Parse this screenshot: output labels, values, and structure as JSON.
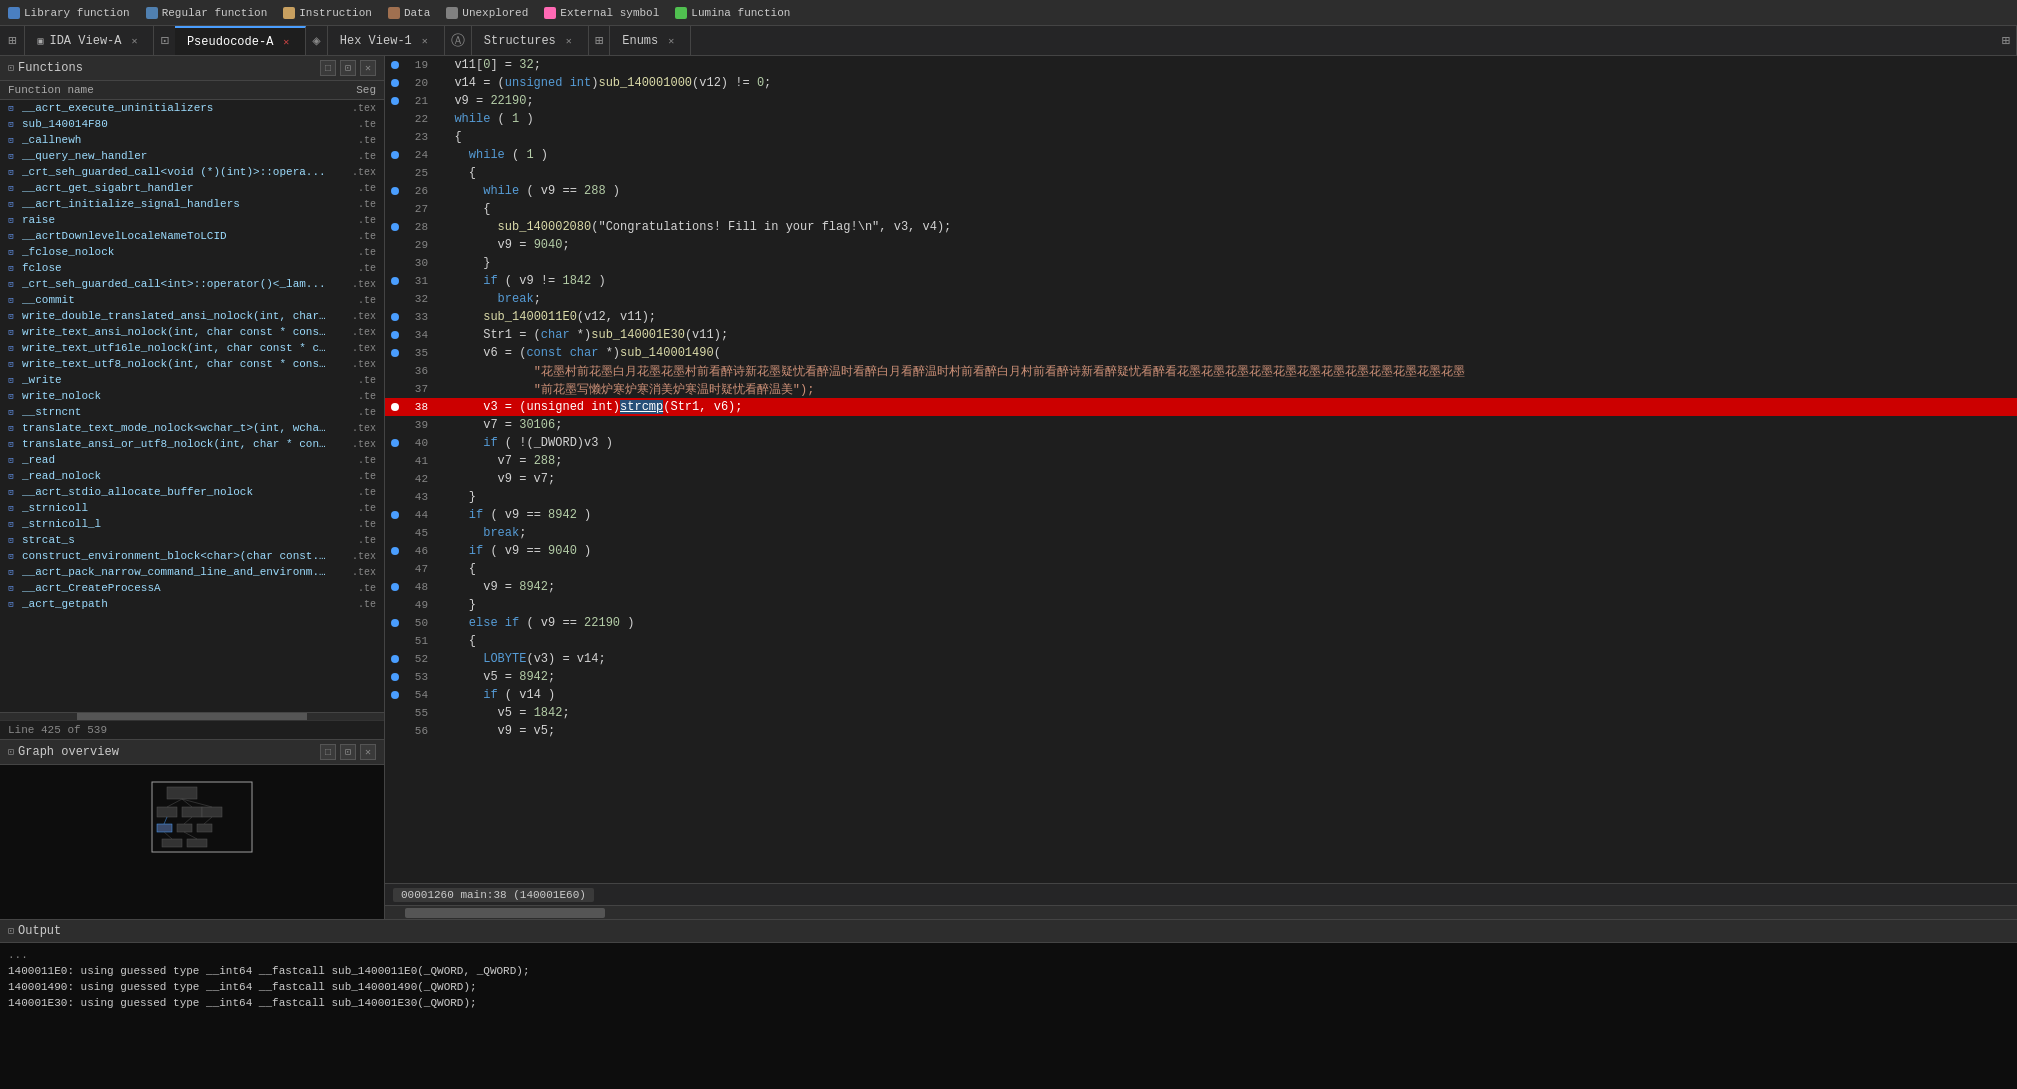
{
  "toolbar": {
    "legend": [
      {
        "label": "Library function",
        "color": "#6495ed"
      },
      {
        "label": "Regular function",
        "color": "#6495ed"
      },
      {
        "label": "Instruction",
        "color": "#c8a060"
      },
      {
        "label": "Data",
        "color": "#c8a060"
      },
      {
        "label": "Unexplored",
        "color": "#808080"
      },
      {
        "label": "External symbol",
        "color": "#ff69b4"
      },
      {
        "label": "Lumina function",
        "color": "#50c050"
      }
    ]
  },
  "tabs": [
    {
      "id": "ida-view",
      "label": "IDA View-A",
      "active": false,
      "closeable": true
    },
    {
      "id": "pseudocode",
      "label": "Pseudocode-A",
      "active": true,
      "closeable": true
    },
    {
      "id": "hex-view",
      "label": "Hex View-1",
      "active": false,
      "closeable": true
    },
    {
      "id": "structures",
      "label": "Structures",
      "active": false,
      "closeable": true
    },
    {
      "id": "enums",
      "label": "Enums",
      "active": false,
      "closeable": true
    }
  ],
  "functions_panel": {
    "title": "Functions",
    "col_name": "Function name",
    "col_seg": "Seg",
    "items": [
      {
        "name": "__acrt_execute_uninitializers",
        "seg": ".tex"
      },
      {
        "name": "sub_140014F80",
        "seg": ".te"
      },
      {
        "name": "_callnewh",
        "seg": ".te"
      },
      {
        "name": "__query_new_handler",
        "seg": ".te"
      },
      {
        "name": "_crt_seh_guarded_call<void (*)(int)>::opera...",
        "seg": ".tex"
      },
      {
        "name": "__acrt_get_sigabrt_handler",
        "seg": ".te"
      },
      {
        "name": "__acrt_initialize_signal_handlers",
        "seg": ".te"
      },
      {
        "name": "raise",
        "seg": ".te"
      },
      {
        "name": "__acrtDownlevelLocaleNameToLCID",
        "seg": ".te"
      },
      {
        "name": "_fclose_nolock",
        "seg": ".te"
      },
      {
        "name": "fclose",
        "seg": ".te"
      },
      {
        "name": "_crt_seh_guarded_call<int>::operator()<_lam...",
        "seg": ".tex"
      },
      {
        "name": "__commit",
        "seg": ".te"
      },
      {
        "name": "write_double_translated_ansi_nolock(int, char...",
        "seg": ".tex"
      },
      {
        "name": "write_text_ansi_nolock(int, char const * cons...",
        "seg": ".tex"
      },
      {
        "name": "write_text_utf16le_nolock(int, char const * c...",
        "seg": ".tex"
      },
      {
        "name": "write_text_utf8_nolock(int, char const * cons...",
        "seg": ".tex"
      },
      {
        "name": "_write",
        "seg": ".te"
      },
      {
        "name": "write_nolock",
        "seg": ".te"
      },
      {
        "name": "__strncnt",
        "seg": ".te"
      },
      {
        "name": "translate_text_mode_nolock<wchar_t>(int, wcha...",
        "seg": ".tex"
      },
      {
        "name": "translate_ansi_or_utf8_nolock(int, char * con...",
        "seg": ".tex"
      },
      {
        "name": "_read",
        "seg": ".te"
      },
      {
        "name": "_read_nolock",
        "seg": ".te"
      },
      {
        "name": "__acrt_stdio_allocate_buffer_nolock",
        "seg": ".te"
      },
      {
        "name": "_strnicoll",
        "seg": ".te"
      },
      {
        "name": "_strnicoll_l",
        "seg": ".te"
      },
      {
        "name": "strcat_s",
        "seg": ".te"
      },
      {
        "name": "construct_environment_block<char>(char const...",
        "seg": ".tex"
      },
      {
        "name": "__acrt_pack_narrow_command_line_and_environm...",
        "seg": ".tex"
      },
      {
        "name": "__acrt_CreateProcessA",
        "seg": ".te"
      },
      {
        "name": "_acrt_getpath",
        "seg": ".te"
      }
    ]
  },
  "line_info": "Line 425 of 539",
  "graph_panel": {
    "title": "Graph overview"
  },
  "code": {
    "lines": [
      {
        "num": 19,
        "bullet": true,
        "text": "  v11[0] = 32;",
        "highlight": false
      },
      {
        "num": 20,
        "bullet": true,
        "text": "  v14 = (unsigned int)sub_140001000(v12) != 0;",
        "highlight": false
      },
      {
        "num": 21,
        "bullet": true,
        "text": "  v9 = 22190;",
        "highlight": false
      },
      {
        "num": 22,
        "bullet": false,
        "text": "  while ( 1 )",
        "highlight": false
      },
      {
        "num": 23,
        "bullet": false,
        "text": "  {",
        "highlight": false
      },
      {
        "num": 24,
        "bullet": true,
        "text": "    while ( 1 )",
        "highlight": false
      },
      {
        "num": 25,
        "bullet": false,
        "text": "    {",
        "highlight": false
      },
      {
        "num": 26,
        "bullet": true,
        "text": "      while ( v9 == 288 )",
        "highlight": false
      },
      {
        "num": 27,
        "bullet": false,
        "text": "      {",
        "highlight": false
      },
      {
        "num": 28,
        "bullet": true,
        "text": "        sub_140002080(\"Congratulations! Fill in your flag!\\n\", v3, v4);",
        "highlight": false
      },
      {
        "num": 29,
        "bullet": false,
        "text": "        v9 = 9040;",
        "highlight": false
      },
      {
        "num": 30,
        "bullet": false,
        "text": "      }",
        "highlight": false
      },
      {
        "num": 31,
        "bullet": true,
        "text": "      if ( v9 != 1842 )",
        "highlight": false
      },
      {
        "num": 32,
        "bullet": false,
        "text": "        break;",
        "highlight": false
      },
      {
        "num": 33,
        "bullet": true,
        "text": "      sub_1400011E0(v12, v11);",
        "highlight": false
      },
      {
        "num": 34,
        "bullet": true,
        "text": "      Str1 = (char *)sub_140001E30(v11);",
        "highlight": false
      },
      {
        "num": 35,
        "bullet": true,
        "text": "      v6 = (const char *)sub_140001490(",
        "highlight": false
      },
      {
        "num": 36,
        "bullet": false,
        "text": "             \"\\u82b1\\u5893\\u6751\\u524d\\u82b1\\u5893\\u767d\\u6708\\u82b1\\u5893\\u82b1\\u5893\\u6751\\u524d\\u770b\\u9192\\u8bd7\\u65b0\\u82b1\\u5893\\u75d1\\u60b9\\u770b\\u9192\\u6e29\\u65f6\\u770b\\u9192\\u767d\\u6708\\u770b\\u9192\\u6e29\\u65f6\\u6751\\u524d\\u770b\\u9192\\u767d\\u6708\\u6751\\u524d\\u770b\\u9192\\u8bd7\\u65b0\\u770b\\u9192\\u75d1\\u60b9\\u770b\\u9192\\u770b\\u82b1\\u5893\\u82b1\\u5893\\u82b1\\u5893\\u82b1\\u5893\\u82b1\\u5893\\u82b1\\u5893\\u82b1\\u5893\\u82b1\\u5893\\u82b1\\u5893\\u82b1\\u5893\\u82b1\\u5893\\u82b1\\u5893",
        "highlight": false
      },
      {
        "num": 37,
        "bullet": false,
        "text": "             \"\\u524d\\u82b1\\u5893\\u5199\\u61d2\\u7089\\u5be8\\u7089\\u5bd2\\u6d88\\u7f8e\\u7089\\u5bd2\\u6e29\\u65f6\\u75d1\\u60b9\\u770b\\u9192\\u6e29\\u7f8e\");",
        "highlight": false
      },
      {
        "num": 38,
        "bullet": true,
        "text": "      v3 = (unsigned int)strcmp(Str1, v6);",
        "highlight": true
      },
      {
        "num": 39,
        "bullet": false,
        "text": "      v7 = 30106;",
        "highlight": false
      },
      {
        "num": 40,
        "bullet": true,
        "text": "      if ( !(_DWORD)v3 )",
        "highlight": false
      },
      {
        "num": 41,
        "bullet": false,
        "text": "        v7 = 288;",
        "highlight": false
      },
      {
        "num": 42,
        "bullet": false,
        "text": "        v9 = v7;",
        "highlight": false
      },
      {
        "num": 43,
        "bullet": false,
        "text": "    }",
        "highlight": false
      },
      {
        "num": 44,
        "bullet": true,
        "text": "    if ( v9 == 8942 )",
        "highlight": false
      },
      {
        "num": 45,
        "bullet": false,
        "text": "      break;",
        "highlight": false
      },
      {
        "num": 46,
        "bullet": true,
        "text": "    if ( v9 == 9040 )",
        "highlight": false
      },
      {
        "num": 47,
        "bullet": false,
        "text": "    {",
        "highlight": false
      },
      {
        "num": 48,
        "bullet": true,
        "text": "      v9 = 8942;",
        "highlight": false
      },
      {
        "num": 49,
        "bullet": false,
        "text": "    }",
        "highlight": false
      },
      {
        "num": 50,
        "bullet": true,
        "text": "    else if ( v9 == 22190 )",
        "highlight": false
      },
      {
        "num": 51,
        "bullet": false,
        "text": "    {",
        "highlight": false
      },
      {
        "num": 52,
        "bullet": true,
        "text": "      LOBYTE(v3) = v14;",
        "highlight": false
      },
      {
        "num": 53,
        "bullet": true,
        "text": "      v5 = 8942;",
        "highlight": false
      },
      {
        "num": 54,
        "bullet": true,
        "text": "      if ( v14 )",
        "highlight": false
      },
      {
        "num": 55,
        "bullet": false,
        "text": "        v5 = 1842;",
        "highlight": false
      },
      {
        "num": 56,
        "bullet": false,
        "text": "        v9 = v5;",
        "highlight": false
      }
    ]
  },
  "status": {
    "text": "00001260 main:38 (140001E60)"
  },
  "output_panel": {
    "title": "Output",
    "lines": [
      "1400011E0: using guessed type __int64 __fastcall sub_1400011E0(_QWORD, _QWORD);",
      "140001490: using guessed type __int64 __fastcall sub_140001490(_QWORD);",
      "140001E30: using guessed type __int64 __fastcall sub_140001E30(_QWORD);"
    ]
  },
  "colors": {
    "bg": "#1e1e1e",
    "panel_bg": "#2d2d2d",
    "highlight_row": "#cc0000",
    "accent": "#4a9eff",
    "text_muted": "#858585",
    "keyword": "#569cd6",
    "string": "#ce9178",
    "number": "#b5cea8",
    "function_color": "#dcdcaa",
    "variable": "#9cdcfe"
  }
}
